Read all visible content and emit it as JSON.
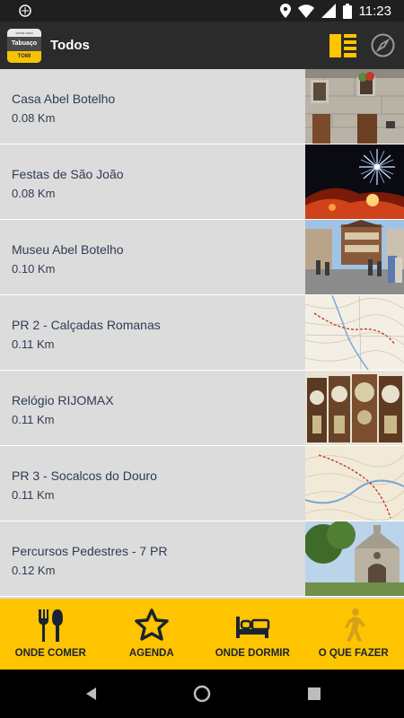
{
  "status_bar": {
    "time": "11:23"
  },
  "app_bar": {
    "title": "Todos",
    "logo": {
      "top_text": "santa casa",
      "mid_text": "Tabuaço",
      "bottom_text": "TOMI"
    }
  },
  "places": [
    {
      "name": "Casa Abel Botelho",
      "distance": "0.08 Km",
      "thumb": "stone-house-photo"
    },
    {
      "name": "Festas de São João",
      "distance": "0.08 Km",
      "thumb": "fireworks-photo"
    },
    {
      "name": "Museu Abel Botelho",
      "distance": "0.10 Km",
      "thumb": "street-museum-photo"
    },
    {
      "name": "PR 2 - Calçadas Romanas",
      "distance": "0.11 Km",
      "thumb": "trail-map"
    },
    {
      "name": "Relógio RIJOMAX",
      "distance": "0.11 Km",
      "thumb": "clocks-photo"
    },
    {
      "name": "PR 3 - Socalcos do Douro",
      "distance": "0.11 Km",
      "thumb": "trail-map"
    },
    {
      "name": "Percursos Pedestres - 7 PR",
      "distance": "0.12 Km",
      "thumb": "chapel-photo"
    }
  ],
  "bottom_nav": [
    {
      "label": "ONDE COMER",
      "icon": "fork-spoon-icon"
    },
    {
      "label": "AGENDA",
      "icon": "star-icon"
    },
    {
      "label": "ONDE DORMIR",
      "icon": "bed-icon"
    },
    {
      "label": "O QUE FAZER",
      "icon": "hiker-icon"
    }
  ],
  "colors": {
    "accent": "#ffc400",
    "app_bar": "#2b2b2b",
    "list_bg": "#dcdcdc",
    "text": "#2f3c52"
  }
}
